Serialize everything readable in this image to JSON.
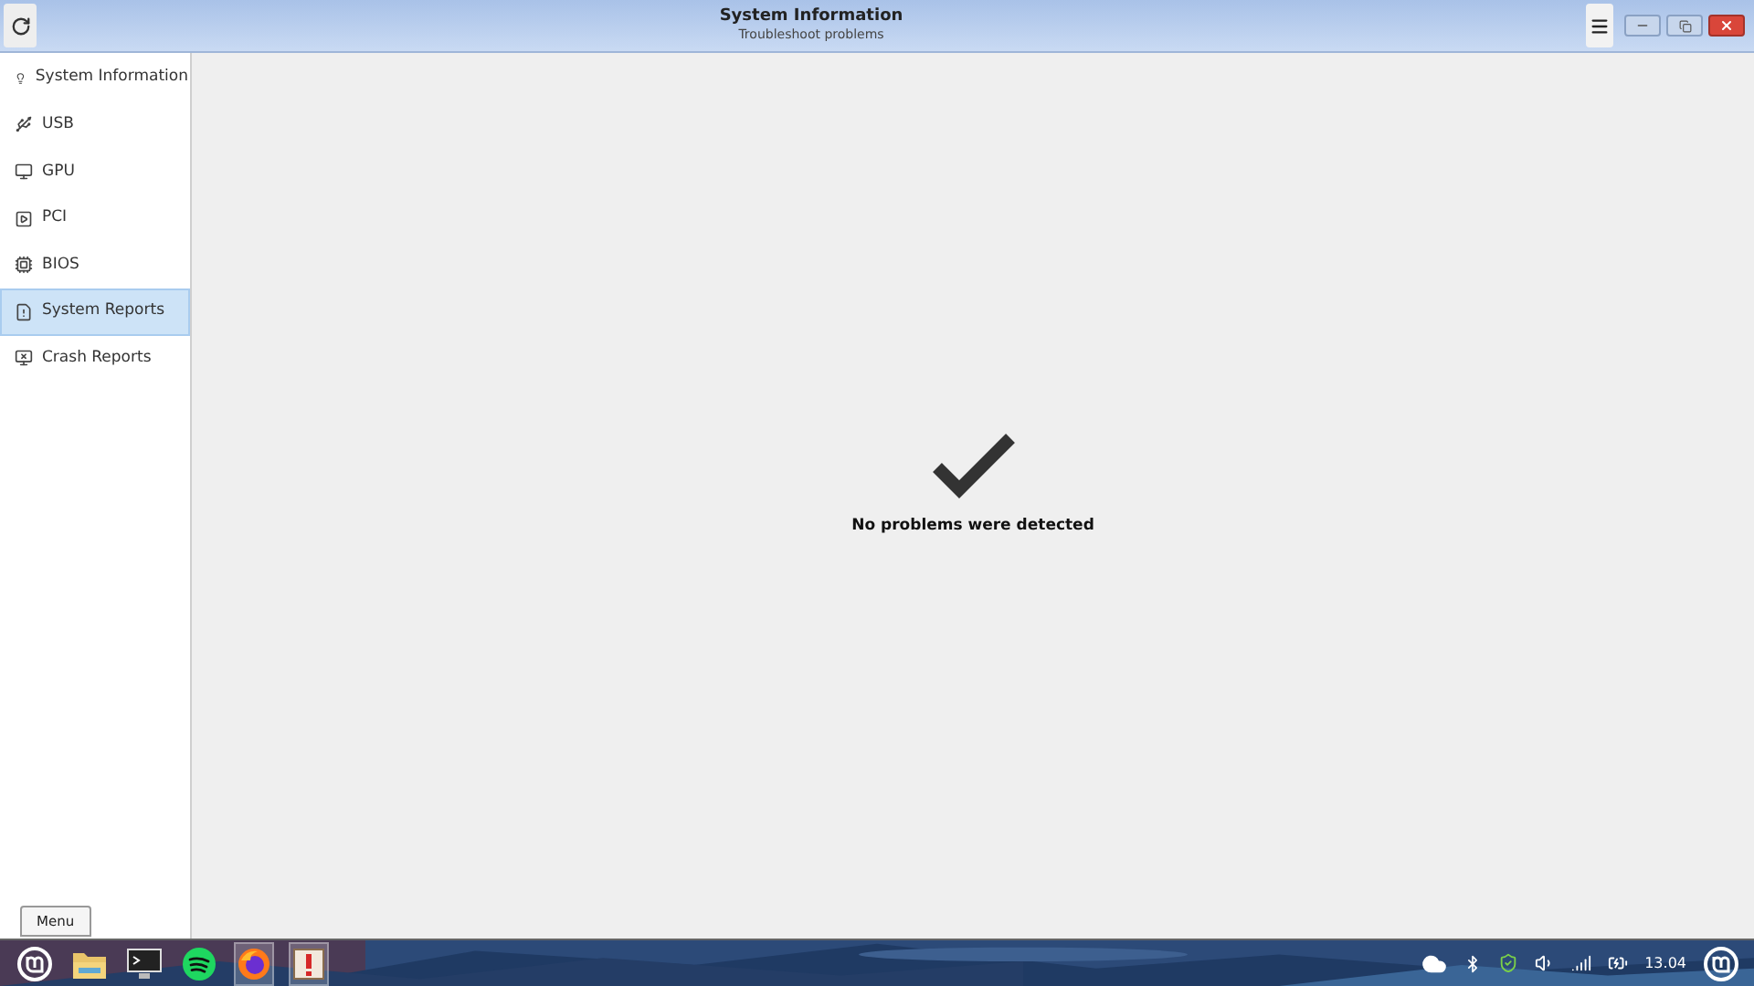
{
  "window": {
    "title": "System Information",
    "subtitle": "Troubleshoot problems"
  },
  "sidebar": {
    "items": [
      {
        "label": "System Information",
        "kind": "bulb",
        "selected": false
      },
      {
        "label": "USB",
        "kind": "usb",
        "selected": false
      },
      {
        "label": "GPU",
        "kind": "monitor",
        "selected": false
      },
      {
        "label": "PCI",
        "kind": "card",
        "selected": false
      },
      {
        "label": "BIOS",
        "kind": "chip",
        "selected": false
      },
      {
        "label": "System Reports",
        "kind": "report",
        "selected": true
      },
      {
        "label": "Crash Reports",
        "kind": "crash",
        "selected": false
      }
    ]
  },
  "status": {
    "message": "No problems were detected"
  },
  "tooltip": {
    "text": "Menu"
  },
  "taskbar": {
    "apps": [
      {
        "kind": "mint",
        "active": false
      },
      {
        "kind": "files",
        "active": false
      },
      {
        "kind": "terminal",
        "active": false
      },
      {
        "kind": "spotify",
        "active": false
      },
      {
        "kind": "firefox",
        "active": true
      },
      {
        "kind": "report",
        "active": true
      }
    ],
    "clock": "13.04"
  }
}
